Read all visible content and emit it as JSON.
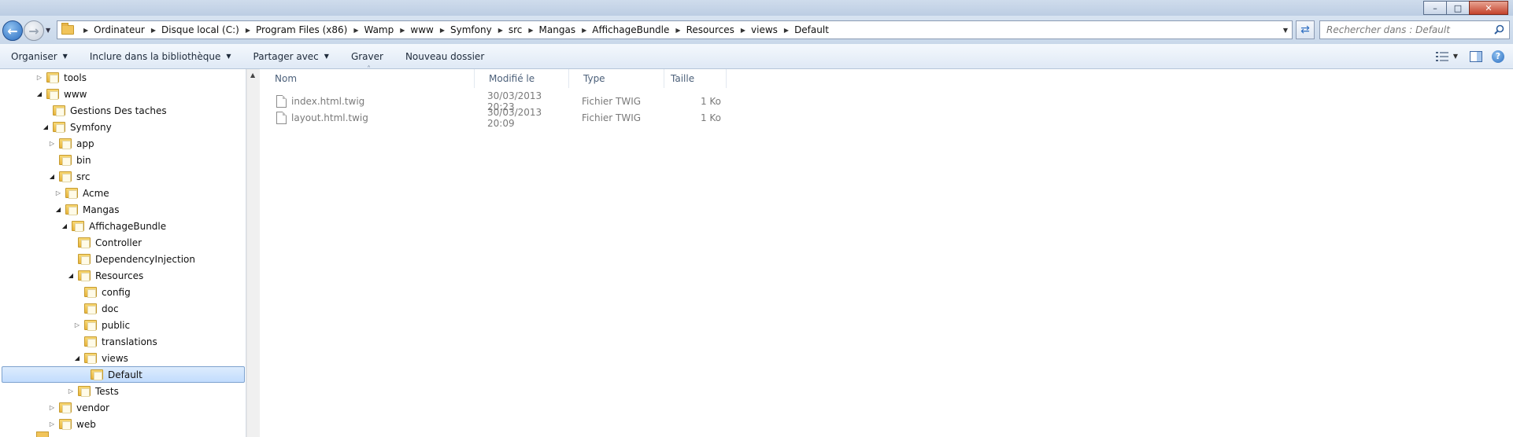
{
  "window": {
    "minimize_label": "–",
    "maximize_label": "□",
    "close_label": "✕"
  },
  "navigation": {
    "back_label": "←",
    "forward_label": "→"
  },
  "address": {
    "crumbs": [
      "Ordinateur",
      "Disque local (C:)",
      "Program Files (x86)",
      "Wamp",
      "www",
      "Symfony",
      "src",
      "Mangas",
      "AffichageBundle",
      "Resources",
      "views",
      "Default"
    ]
  },
  "search": {
    "placeholder": "Rechercher dans : Default"
  },
  "toolbar": {
    "organize": "Organiser",
    "include_library": "Inclure dans la bibliothèque",
    "share_with": "Partager avec",
    "burn": "Graver",
    "new_folder": "Nouveau dossier"
  },
  "tree": [
    {
      "label": "tools",
      "toggle": "▷"
    },
    {
      "label": "www",
      "toggle": "◢"
    },
    {
      "label": "Gestions Des taches",
      "toggle": ""
    },
    {
      "label": "Symfony",
      "toggle": "◢"
    },
    {
      "label": "app",
      "toggle": "▷"
    },
    {
      "label": "bin",
      "toggle": ""
    },
    {
      "label": "src",
      "toggle": "◢"
    },
    {
      "label": "Acme",
      "toggle": "▷"
    },
    {
      "label": "Mangas",
      "toggle": "◢"
    },
    {
      "label": "AffichageBundle",
      "toggle": "◢"
    },
    {
      "label": "Controller",
      "toggle": ""
    },
    {
      "label": "DependencyInjection",
      "toggle": ""
    },
    {
      "label": "Resources",
      "toggle": "◢"
    },
    {
      "label": "config",
      "toggle": ""
    },
    {
      "label": "doc",
      "toggle": ""
    },
    {
      "label": "public",
      "toggle": "▷"
    },
    {
      "label": "translations",
      "toggle": ""
    },
    {
      "label": "views",
      "toggle": "◢"
    },
    {
      "label": "Default",
      "toggle": "",
      "selected": true
    },
    {
      "label": "Tests",
      "toggle": "▷"
    },
    {
      "label": "vendor",
      "toggle": "▷"
    },
    {
      "label": "web",
      "toggle": "▷"
    }
  ],
  "columns": {
    "name": "Nom",
    "modified": "Modifié le",
    "type": "Type",
    "size": "Taille"
  },
  "files": [
    {
      "name": "index.html.twig",
      "modified": "30/03/2013 20:23",
      "type": "Fichier TWIG",
      "size": "1 Ko"
    },
    {
      "name": "layout.html.twig",
      "modified": "30/03/2013 20:09",
      "type": "Fichier TWIG",
      "size": "1 Ko"
    }
  ],
  "colors": {
    "selection": "#c2dcfd",
    "accent": "#2a6dc0"
  }
}
